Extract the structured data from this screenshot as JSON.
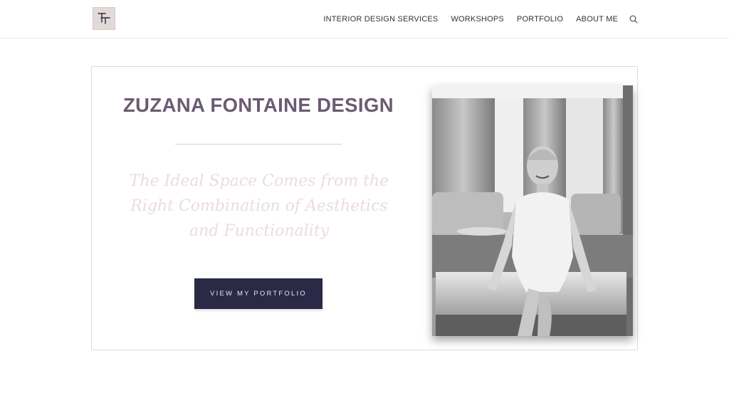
{
  "header": {
    "logo_icon": "monogram-logo-icon",
    "nav": [
      {
        "label": "INTERIOR DESIGN SERVICES"
      },
      {
        "label": "WORKSHOPS"
      },
      {
        "label": "PORTFOLIO"
      },
      {
        "label": "ABOUT ME"
      }
    ],
    "search_icon": "search-icon"
  },
  "hero": {
    "title": "ZUZANA FONTAINE DESIGN",
    "tagline": "The Ideal Space Comes from the Right Combination of Aesthetics and Functionality",
    "cta_label": "VIEW MY PORTFOLIO",
    "photo_icon": "portrait-photo"
  },
  "colors": {
    "title": "#6d5a73",
    "tagline": "#eadcdf",
    "cta_bg": "#2a2a47",
    "logo_bg": "#e3d9d6"
  }
}
